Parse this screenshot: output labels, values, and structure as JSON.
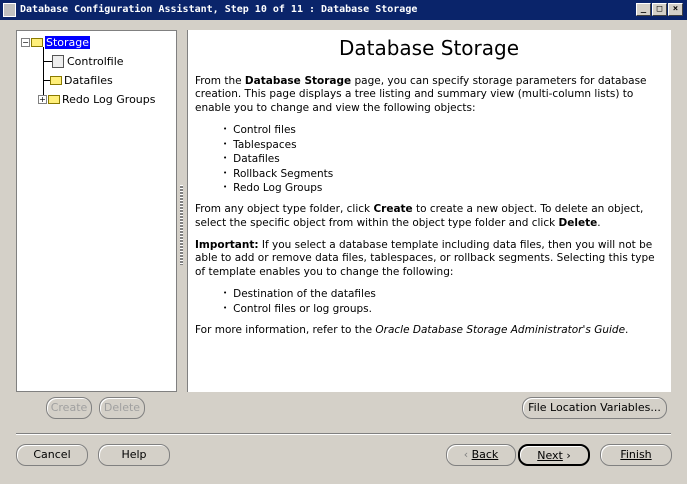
{
  "window": {
    "title": "Database Configuration Assistant, Step 10 of 11 : Database Storage",
    "minimize": "_",
    "maximize": "□",
    "close": "×"
  },
  "tree": {
    "root": "Storage",
    "children": [
      "Controlfile",
      "Datafiles",
      "Redo Log Groups"
    ]
  },
  "content": {
    "heading": "Database Storage",
    "p1_a": "From the ",
    "p1_b": "Database Storage",
    "p1_c": " page, you can specify storage parameters for database creation. This page displays a tree listing and summary view (multi-column lists) to enable you to change and view the following objects:",
    "list1": [
      "Control files",
      "Tablespaces",
      "Datafiles",
      "Rollback Segments",
      "Redo Log Groups"
    ],
    "p2_a": "From any object type folder, click ",
    "p2_b": "Create",
    "p2_c": " to create a new object. To delete an object, select the specific object from within the object type folder and click ",
    "p2_d": "Delete",
    "p2_e": ".",
    "p3_a": "Important:",
    "p3_b": " If you select a database template including data files, then you will not be able to add or remove data files, tablespaces, or rollback segments. Selecting this type of template enables you to change the following:",
    "list2": [
      "Destination of the datafiles",
      "Control files or log groups."
    ],
    "p4_a": "For more information, refer to the ",
    "p4_b": "Oracle Database Storage Administrator's Guide",
    "p4_c": "."
  },
  "buttons": {
    "create": "Create",
    "delete": "Delete",
    "file_location": "File Location Variables...",
    "cancel": "Cancel",
    "help": "Help",
    "back": "Back",
    "next": "Next",
    "finish": "Finish"
  }
}
